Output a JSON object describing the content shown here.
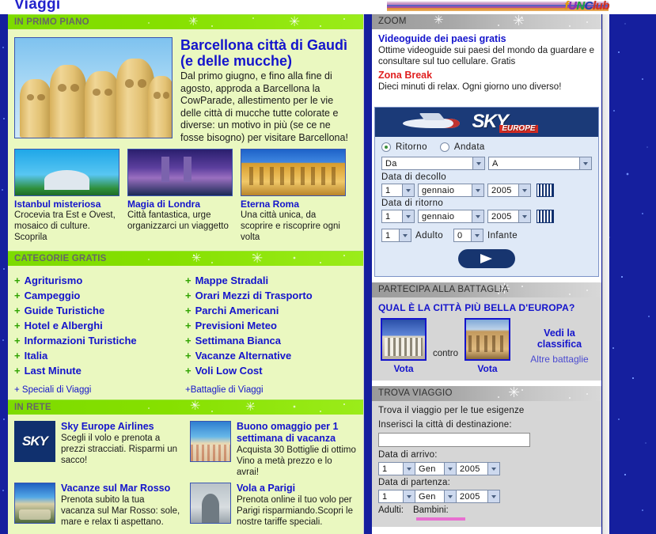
{
  "header": {
    "page_title": "Viaggi",
    "brand_logo_parts": [
      "f",
      "U",
      "N",
      "Club"
    ],
    "brand_logo_text": "fUNClub"
  },
  "left_column": {
    "sections": [
      {
        "id": "in-primo-piano",
        "title": "IN PRIMO PIANO"
      },
      {
        "id": "categorie-gratis",
        "title": "CATEGORIE GRATIS"
      },
      {
        "id": "in-rete",
        "title": "IN RETE"
      }
    ],
    "featured": {
      "image_alt": "barcelona-gaudi-chimneys",
      "title": "Barcellona città di Gaudì (e delle mucche)",
      "body": "Dal primo giugno, e fino alla fine di agosto, approda a Barcellona la CowParade, allestimento per le vie delle città di mucche tutte colorate e diverse: un motivo in più (se ce ne fosse bisogno) per visitare Barcellona!"
    },
    "thumbs": [
      {
        "image_alt": "istanbul-mosque",
        "title": "Istanbul misteriosa",
        "body": "Crocevia tra Est e Ovest, mosaico di culture. Scoprila"
      },
      {
        "image_alt": "london-tower-bridge",
        "title": "Magia di Londra",
        "body": "Città fantastica, urge organizzarci un viaggetto"
      },
      {
        "image_alt": "rome-colosseum",
        "title": "Eterna Roma",
        "body": "Una città unica, da scoprire e riscoprire ogni volta"
      }
    ],
    "categories_left": [
      "Agriturismo",
      "Campeggio",
      "Guide Turistiche",
      "Hotel e Alberghi",
      "Informazioni Turistiche",
      "Italia",
      "Last Minute"
    ],
    "categories_right": [
      "Mappe Stradali",
      "Orari Mezzi di Trasporto",
      "Parchi Americani",
      "Previsioni Meteo",
      "Settimana Bianca",
      "Vacanze Alternative",
      "Voli Low Cost"
    ],
    "category_sub_left": "+ Speciali di Viaggi",
    "category_sub_right": "+Battaglie di Viaggi",
    "rete_items": [
      {
        "image_alt": "sky-europe-logo",
        "logo_text": "SKY",
        "title": "Sky Europe Airlines",
        "body": "Scegli il volo e prenota a prezzi stracciati. Risparmi un sacco!"
      },
      {
        "image_alt": "beach-umbrellas",
        "title": "Buono omaggio per 1 settimana di vacanza",
        "body": "Acquista 30 Bottiglie di ottimo Vino a metà prezzo e lo avrai!"
      },
      {
        "image_alt": "red-sea-beach",
        "title": "Vacanze sul Mar Rosso",
        "body": "Prenota subito la tua vacanza sul Mar Rosso: sole, mare e relax ti aspettano."
      },
      {
        "image_alt": "arc-de-triomphe",
        "title": "Vola a Parigi",
        "body": "Prenota online il tuo volo per Parigi risparmiando.Scopri le nostre tariffe speciali."
      }
    ]
  },
  "right_column": {
    "zoom": {
      "title": "ZOOM",
      "entries": [
        {
          "link": "Videoguide dei paesi gratis",
          "body": "Ottime videoguide sui paesi del mondo da guardare e consultare sul tuo cellulare. Gratis",
          "color": "#1414cc"
        },
        {
          "link": "Zona Break",
          "body": "Dieci minuti di relax. Ogni giorno uno diverso!",
          "color": "#e02020"
        }
      ]
    },
    "sky_widget": {
      "logo_text": "SKY",
      "logo_sub": "EUROPE",
      "trip_type": {
        "selected": "Ritorno",
        "options": [
          "Ritorno",
          "Andata"
        ]
      },
      "from_label": "Da",
      "to_label": "A",
      "departure_label": "Data di decollo",
      "return_label": "Data di ritorno",
      "departure_date": {
        "day": "1",
        "month": "gennaio",
        "year": "2005"
      },
      "return_date": {
        "day": "1",
        "month": "gennaio",
        "year": "2005"
      },
      "adults": {
        "value": "1",
        "label": "Adulto"
      },
      "infants": {
        "value": "0",
        "label": "Infante"
      },
      "calendar_icon": "calendar-icon",
      "submit_icon": "arrow-right-icon"
    },
    "battaglia": {
      "title": "PARTECIPA ALLA BATTAGLIA",
      "question": "QUAL È LA CITTÀ PIÙ BELLA D'EUROPA?",
      "left": {
        "image_alt": "parthenon-athens",
        "vote_label": "Vota"
      },
      "versus": "contro",
      "right": {
        "image_alt": "colosseum-rome",
        "vote_label": "Vota"
      },
      "link_ranking": "Vedi la classifica",
      "link_other": "Altre battaglie"
    },
    "trova": {
      "title": "TROVA VIAGGIO",
      "intro": "Trova il viaggio per le tue esigenze",
      "destination_label": "Inserisci la città di destinazione:",
      "destination_value": "",
      "destination_placeholder": "",
      "arrival_label": "Data di arrivo:",
      "arrival_date": {
        "day": "1",
        "month": "Gen",
        "year": "2005"
      },
      "departure_label": "Data di partenza:",
      "departure_date": {
        "day": "1",
        "month": "Gen",
        "year": "2005"
      },
      "adults_label": "Adulti:",
      "children_label": "Bambini:"
    }
  },
  "colors": {
    "background_blue": "#151f9e",
    "left_panel_green": "#eaf8c0",
    "bar_green": "#86e000",
    "bar_gray": "#a8a8a8",
    "link_blue": "#1414cc",
    "accent_red": "#e02020",
    "sky_navy": "#1b3a78",
    "panel_gray": "#d6d6d6"
  }
}
